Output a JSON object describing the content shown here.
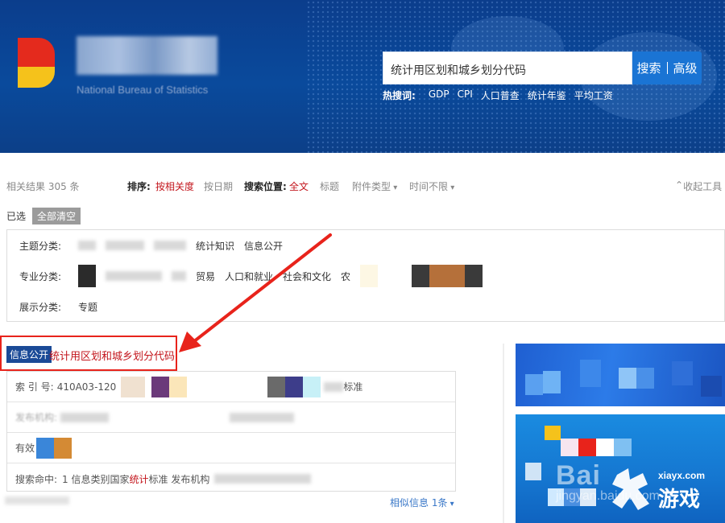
{
  "header": {
    "site_subtitle": "National Bureau of Statistics",
    "search_value": "统计用区划和城乡划分代码",
    "search_label": "搜索",
    "advanced_label": "高级",
    "hot_label": "热搜词:",
    "hot_words": [
      "GDP",
      "CPI",
      "人口普查",
      "统计年鉴",
      "平均工资"
    ]
  },
  "sortbar": {
    "count": "相关结果 305 条",
    "sort_label": "排序:",
    "sort_relevance": "按相关度",
    "sort_date": "按日期",
    "position_label": "搜索位置:",
    "pos_full": "全文",
    "pos_title": "标题",
    "attachment": "附件类型",
    "time": "时间不限",
    "collapse": "收起工具"
  },
  "selected": {
    "label": "已选",
    "clear": "全部清空"
  },
  "filters": {
    "topic_label": "主题分类:",
    "topic_items": [
      "统计知识",
      "信息公开"
    ],
    "pro_label": "专业分类:",
    "pro_items": [
      "贸易",
      "人口和就业",
      "社会和文化",
      "农"
    ],
    "show_label": "展示分类:",
    "show_items": [
      "专题"
    ]
  },
  "result": {
    "tag": "信息公开",
    "title": "统计用区划和城乡划分代码",
    "index_label": "索 引 号:",
    "index_value": "410A03-120",
    "category_suffix": "标准",
    "publisher_label": "发布机构:",
    "valid_label": "有效",
    "hit_label": "搜索命中:",
    "hit_prefix": "1 信息类别国家",
    "hit_red": "统计",
    "hit_suffix": "标准 发布机构",
    "similar": "相似信息 1条"
  },
  "watermark": {
    "baidu": "Bai",
    "baidu_jingyan": "jingyan.baidu.com",
    "site": "xiayx.com",
    "site_cn": "游戏"
  }
}
